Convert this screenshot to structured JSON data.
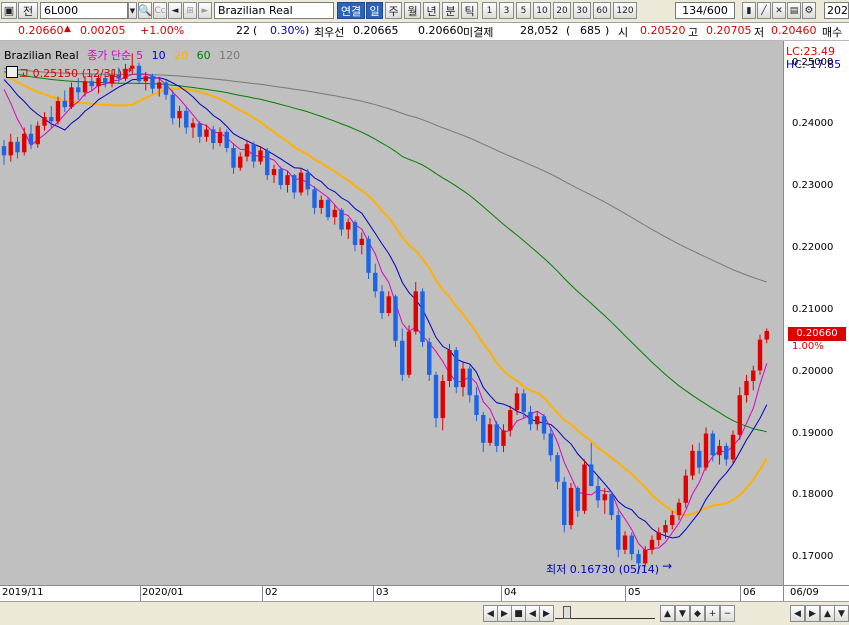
{
  "toolbar": {
    "code": "6L000",
    "search_icon": "search-icon",
    "name": "Brazilian Real",
    "qty": "22",
    "btn_connect": "연결",
    "periods": [
      "일",
      "주",
      "월",
      "년",
      "분",
      "틱"
    ],
    "minutes": [
      "1",
      "3",
      "5",
      "10",
      "20",
      "30",
      "60",
      "120"
    ],
    "count": "134/600",
    "date_fragment": "2020"
  },
  "quote": {
    "price": "0.20660",
    "change": "0.00205",
    "change_pct": "+1.00%",
    "qty": "22",
    "qty_pct": "0.30%",
    "best_label": "최우선",
    "best_value": "0.20665",
    "best_value2": "0.20660",
    "oi_label": "미결제",
    "oi_value": "28,052",
    "oi_change": "685",
    "open_label": "시",
    "open_value": "0.20520",
    "high_label": "고",
    "high_value": "0.20705",
    "low_label": "저",
    "low_value": "0.20460",
    "trade_label": "매수"
  },
  "legend": {
    "name": "Brazilian Real",
    "ma_label": "종가 단순",
    "ma": [
      "5",
      "10",
      "20",
      "60",
      "120"
    ]
  },
  "colors": {
    "bg": "#c0c0c0",
    "up": "#e00000",
    "down": "#1e64e6",
    "ma5": "#e000c8",
    "ma10": "#0000c8",
    "ma20": "#ffb000",
    "ma60": "#008000",
    "ma120": "#787878"
  },
  "annotations": {
    "high": "고 0.25150 (12/31)",
    "low": "최저 0.16730 (05/14)",
    "lc": "LC:23.49",
    "hc": "HC:-17.85",
    "last_price": "0.20660",
    "last_pct": "1.00%"
  },
  "yaxis": {
    "ticks": [
      "0.25000",
      "0.24000",
      "0.23000",
      "0.22000",
      "0.21000",
      "0.20000",
      "0.19000",
      "0.18000",
      "0.17000"
    ]
  },
  "xaxis": {
    "ticks": [
      "2019/11",
      "2020/01",
      "02",
      "03",
      "04",
      "05",
      "06",
      "06/09"
    ]
  },
  "chart_data": {
    "type": "candlestick",
    "ylim": [
      0.1655,
      0.2535
    ],
    "ma_periods": [
      5,
      10,
      20,
      60,
      120
    ],
    "candles": [
      {
        "o": 0.2365,
        "h": 0.2375,
        "l": 0.2335,
        "c": 0.235
      },
      {
        "o": 0.235,
        "h": 0.2385,
        "l": 0.234,
        "c": 0.2372
      },
      {
        "o": 0.2372,
        "h": 0.238,
        "l": 0.2345,
        "c": 0.2355
      },
      {
        "o": 0.2355,
        "h": 0.2395,
        "l": 0.235,
        "c": 0.2385
      },
      {
        "o": 0.2385,
        "h": 0.24,
        "l": 0.236,
        "c": 0.2368
      },
      {
        "o": 0.2368,
        "h": 0.2405,
        "l": 0.2362,
        "c": 0.2398
      },
      {
        "o": 0.2398,
        "h": 0.242,
        "l": 0.239,
        "c": 0.2412
      },
      {
        "o": 0.2412,
        "h": 0.243,
        "l": 0.2395,
        "c": 0.2405
      },
      {
        "o": 0.2405,
        "h": 0.2445,
        "l": 0.24,
        "c": 0.2438
      },
      {
        "o": 0.2438,
        "h": 0.2455,
        "l": 0.242,
        "c": 0.2428
      },
      {
        "o": 0.2428,
        "h": 0.2468,
        "l": 0.2425,
        "c": 0.246
      },
      {
        "o": 0.246,
        "h": 0.2475,
        "l": 0.244,
        "c": 0.2452
      },
      {
        "o": 0.2452,
        "h": 0.2478,
        "l": 0.2445,
        "c": 0.247
      },
      {
        "o": 0.247,
        "h": 0.2482,
        "l": 0.2455,
        "c": 0.2462
      },
      {
        "o": 0.2462,
        "h": 0.248,
        "l": 0.245,
        "c": 0.2475
      },
      {
        "o": 0.2475,
        "h": 0.2485,
        "l": 0.246,
        "c": 0.2466
      },
      {
        "o": 0.2466,
        "h": 0.2488,
        "l": 0.246,
        "c": 0.248
      },
      {
        "o": 0.248,
        "h": 0.2492,
        "l": 0.2468,
        "c": 0.2474
      },
      {
        "o": 0.2474,
        "h": 0.2498,
        "l": 0.247,
        "c": 0.249
      },
      {
        "o": 0.249,
        "h": 0.2515,
        "l": 0.2482,
        "c": 0.2495
      },
      {
        "o": 0.2495,
        "h": 0.25,
        "l": 0.2465,
        "c": 0.247
      },
      {
        "o": 0.247,
        "h": 0.2485,
        "l": 0.2455,
        "c": 0.2478
      },
      {
        "o": 0.2478,
        "h": 0.2482,
        "l": 0.245,
        "c": 0.2458
      },
      {
        "o": 0.2458,
        "h": 0.2475,
        "l": 0.2445,
        "c": 0.2468
      },
      {
        "o": 0.2468,
        "h": 0.2472,
        "l": 0.244,
        "c": 0.2448
      },
      {
        "o": 0.2448,
        "h": 0.2455,
        "l": 0.24,
        "c": 0.241
      },
      {
        "o": 0.241,
        "h": 0.243,
        "l": 0.2395,
        "c": 0.2422
      },
      {
        "o": 0.2422,
        "h": 0.2428,
        "l": 0.2385,
        "c": 0.2395
      },
      {
        "o": 0.2395,
        "h": 0.241,
        "l": 0.2378,
        "c": 0.2402
      },
      {
        "o": 0.2402,
        "h": 0.2405,
        "l": 0.237,
        "c": 0.238
      },
      {
        "o": 0.238,
        "h": 0.24,
        "l": 0.2372,
        "c": 0.2392
      },
      {
        "o": 0.2392,
        "h": 0.2398,
        "l": 0.236,
        "c": 0.237
      },
      {
        "o": 0.237,
        "h": 0.2395,
        "l": 0.2365,
        "c": 0.2388
      },
      {
        "o": 0.2388,
        "h": 0.2392,
        "l": 0.2355,
        "c": 0.2362
      },
      {
        "o": 0.2362,
        "h": 0.237,
        "l": 0.232,
        "c": 0.233
      },
      {
        "o": 0.233,
        "h": 0.2355,
        "l": 0.2325,
        "c": 0.2348
      },
      {
        "o": 0.2348,
        "h": 0.2375,
        "l": 0.234,
        "c": 0.2368
      },
      {
        "o": 0.2368,
        "h": 0.2372,
        "l": 0.233,
        "c": 0.234
      },
      {
        "o": 0.234,
        "h": 0.2365,
        "l": 0.2335,
        "c": 0.2358
      },
      {
        "o": 0.2358,
        "h": 0.2362,
        "l": 0.231,
        "c": 0.2318
      },
      {
        "o": 0.2318,
        "h": 0.2335,
        "l": 0.2305,
        "c": 0.2328
      },
      {
        "o": 0.2328,
        "h": 0.2332,
        "l": 0.2295,
        "c": 0.2302
      },
      {
        "o": 0.2302,
        "h": 0.2325,
        "l": 0.229,
        "c": 0.2318
      },
      {
        "o": 0.2318,
        "h": 0.232,
        "l": 0.228,
        "c": 0.229
      },
      {
        "o": 0.229,
        "h": 0.233,
        "l": 0.2285,
        "c": 0.2322
      },
      {
        "o": 0.2322,
        "h": 0.2328,
        "l": 0.2285,
        "c": 0.2295
      },
      {
        "o": 0.2295,
        "h": 0.23,
        "l": 0.2255,
        "c": 0.2265
      },
      {
        "o": 0.2265,
        "h": 0.2285,
        "l": 0.2255,
        "c": 0.2278
      },
      {
        "o": 0.2278,
        "h": 0.2282,
        "l": 0.2245,
        "c": 0.225
      },
      {
        "o": 0.225,
        "h": 0.227,
        "l": 0.2238,
        "c": 0.2262
      },
      {
        "o": 0.2262,
        "h": 0.2265,
        "l": 0.222,
        "c": 0.223
      },
      {
        "o": 0.223,
        "h": 0.2248,
        "l": 0.2215,
        "c": 0.2242
      },
      {
        "o": 0.2242,
        "h": 0.2245,
        "l": 0.2195,
        "c": 0.2205
      },
      {
        "o": 0.2205,
        "h": 0.2225,
        "l": 0.219,
        "c": 0.2215
      },
      {
        "o": 0.2215,
        "h": 0.222,
        "l": 0.215,
        "c": 0.216
      },
      {
        "o": 0.216,
        "h": 0.2175,
        "l": 0.212,
        "c": 0.213
      },
      {
        "o": 0.213,
        "h": 0.214,
        "l": 0.2085,
        "c": 0.2095
      },
      {
        "o": 0.2095,
        "h": 0.213,
        "l": 0.209,
        "c": 0.2122
      },
      {
        "o": 0.2122,
        "h": 0.2125,
        "l": 0.204,
        "c": 0.205
      },
      {
        "o": 0.205,
        "h": 0.207,
        "l": 0.1985,
        "c": 0.1995
      },
      {
        "o": 0.1995,
        "h": 0.2075,
        "l": 0.199,
        "c": 0.2065
      },
      {
        "o": 0.2065,
        "h": 0.2145,
        "l": 0.206,
        "c": 0.213
      },
      {
        "o": 0.213,
        "h": 0.2135,
        "l": 0.204,
        "c": 0.2048
      },
      {
        "o": 0.2048,
        "h": 0.2055,
        "l": 0.1985,
        "c": 0.1995
      },
      {
        "o": 0.1995,
        "h": 0.2,
        "l": 0.191,
        "c": 0.1925
      },
      {
        "o": 0.1925,
        "h": 0.1995,
        "l": 0.1905,
        "c": 0.1985
      },
      {
        "o": 0.1985,
        "h": 0.2045,
        "l": 0.1975,
        "c": 0.2035
      },
      {
        "o": 0.2035,
        "h": 0.204,
        "l": 0.1965,
        "c": 0.1975
      },
      {
        "o": 0.1975,
        "h": 0.2015,
        "l": 0.196,
        "c": 0.2005
      },
      {
        "o": 0.2005,
        "h": 0.201,
        "l": 0.195,
        "c": 0.1962
      },
      {
        "o": 0.1962,
        "h": 0.1975,
        "l": 0.192,
        "c": 0.193
      },
      {
        "o": 0.193,
        "h": 0.1935,
        "l": 0.187,
        "c": 0.1885
      },
      {
        "o": 0.1885,
        "h": 0.1925,
        "l": 0.188,
        "c": 0.1915
      },
      {
        "o": 0.1915,
        "h": 0.192,
        "l": 0.187,
        "c": 0.188
      },
      {
        "o": 0.188,
        "h": 0.1915,
        "l": 0.187,
        "c": 0.1905
      },
      {
        "o": 0.1905,
        "h": 0.1945,
        "l": 0.1895,
        "c": 0.1938
      },
      {
        "o": 0.1938,
        "h": 0.1975,
        "l": 0.193,
        "c": 0.1965
      },
      {
        "o": 0.1965,
        "h": 0.1972,
        "l": 0.1925,
        "c": 0.1935
      },
      {
        "o": 0.1935,
        "h": 0.1945,
        "l": 0.1905,
        "c": 0.1915
      },
      {
        "o": 0.1915,
        "h": 0.1935,
        "l": 0.1905,
        "c": 0.1928
      },
      {
        "o": 0.1928,
        "h": 0.1932,
        "l": 0.189,
        "c": 0.19
      },
      {
        "o": 0.19,
        "h": 0.191,
        "l": 0.1855,
        "c": 0.1865
      },
      {
        "o": 0.1865,
        "h": 0.187,
        "l": 0.181,
        "c": 0.1822
      },
      {
        "o": 0.1822,
        "h": 0.183,
        "l": 0.174,
        "c": 0.1752
      },
      {
        "o": 0.1752,
        "h": 0.182,
        "l": 0.1745,
        "c": 0.1812
      },
      {
        "o": 0.1812,
        "h": 0.1815,
        "l": 0.1765,
        "c": 0.1775
      },
      {
        "o": 0.1775,
        "h": 0.1858,
        "l": 0.177,
        "c": 0.185
      },
      {
        "o": 0.185,
        "h": 0.1885,
        "l": 0.184,
        "c": 0.1815
      },
      {
        "o": 0.1815,
        "h": 0.183,
        "l": 0.178,
        "c": 0.1792
      },
      {
        "o": 0.1792,
        "h": 0.1812,
        "l": 0.177,
        "c": 0.1802
      },
      {
        "o": 0.1802,
        "h": 0.1805,
        "l": 0.176,
        "c": 0.1768
      },
      {
        "o": 0.1768,
        "h": 0.1775,
        "l": 0.17,
        "c": 0.1712
      },
      {
        "o": 0.1712,
        "h": 0.1742,
        "l": 0.1705,
        "c": 0.1735
      },
      {
        "o": 0.1735,
        "h": 0.174,
        "l": 0.1695,
        "c": 0.1705
      },
      {
        "o": 0.1705,
        "h": 0.1712,
        "l": 0.1673,
        "c": 0.169
      },
      {
        "o": 0.169,
        "h": 0.1718,
        "l": 0.1685,
        "c": 0.1712
      },
      {
        "o": 0.1712,
        "h": 0.1735,
        "l": 0.1705,
        "c": 0.1728
      },
      {
        "o": 0.1728,
        "h": 0.1748,
        "l": 0.1718,
        "c": 0.174
      },
      {
        "o": 0.174,
        "h": 0.176,
        "l": 0.173,
        "c": 0.1752
      },
      {
        "o": 0.1752,
        "h": 0.1775,
        "l": 0.1745,
        "c": 0.1768
      },
      {
        "o": 0.1768,
        "h": 0.1795,
        "l": 0.176,
        "c": 0.1788
      },
      {
        "o": 0.1788,
        "h": 0.1842,
        "l": 0.178,
        "c": 0.1832
      },
      {
        "o": 0.1832,
        "h": 0.1882,
        "l": 0.1825,
        "c": 0.1872
      },
      {
        "o": 0.1872,
        "h": 0.1885,
        "l": 0.1835,
        "c": 0.1845
      },
      {
        "o": 0.1845,
        "h": 0.191,
        "l": 0.184,
        "c": 0.19
      },
      {
        "o": 0.19,
        "h": 0.1905,
        "l": 0.1855,
        "c": 0.1865
      },
      {
        "o": 0.1865,
        "h": 0.189,
        "l": 0.185,
        "c": 0.188
      },
      {
        "o": 0.188,
        "h": 0.1885,
        "l": 0.1848,
        "c": 0.1858
      },
      {
        "o": 0.1858,
        "h": 0.1905,
        "l": 0.1852,
        "c": 0.1898
      },
      {
        "o": 0.1898,
        "h": 0.1975,
        "l": 0.189,
        "c": 0.1962
      },
      {
        "o": 0.1962,
        "h": 0.1995,
        "l": 0.195,
        "c": 0.1985
      },
      {
        "o": 0.1985,
        "h": 0.201,
        "l": 0.197,
        "c": 0.2002
      },
      {
        "o": 0.2002,
        "h": 0.206,
        "l": 0.1995,
        "c": 0.2052
      },
      {
        "o": 0.2052,
        "h": 0.207,
        "l": 0.2046,
        "c": 0.2066
      }
    ]
  }
}
